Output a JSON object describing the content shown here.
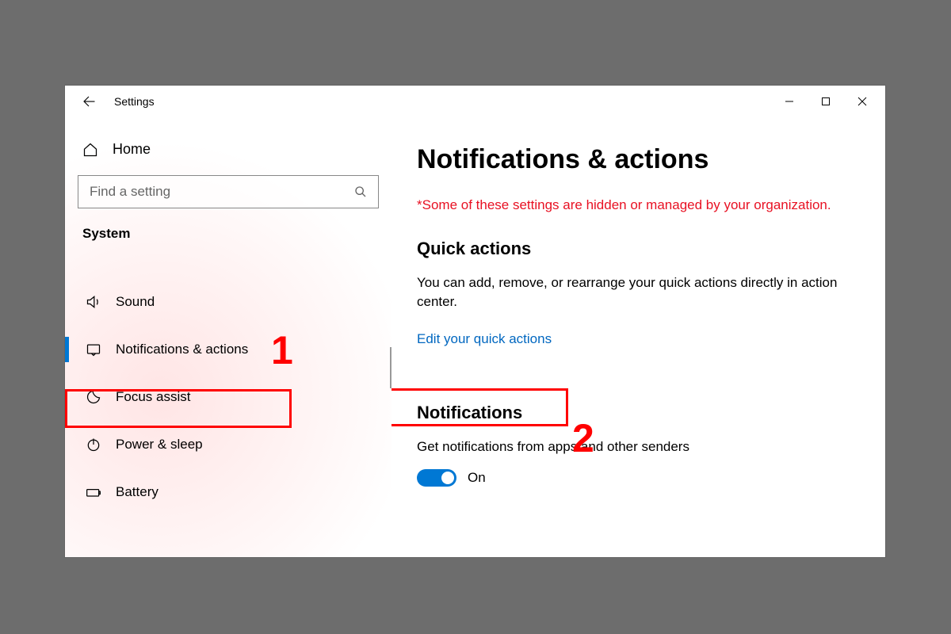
{
  "titlebar": {
    "app_title": "Settings"
  },
  "window_controls": {
    "minimize_name": "minimize-icon",
    "maximize_name": "maximize-icon",
    "close_name": "close-icon"
  },
  "sidebar": {
    "home_label": "Home",
    "search_placeholder": "Find a setting",
    "category_label": "System",
    "items": [
      {
        "icon": "sound-icon",
        "label": "Sound",
        "selected": false
      },
      {
        "icon": "notifications-icon",
        "label": "Notifications & actions",
        "selected": true
      },
      {
        "icon": "focus-assist-icon",
        "label": "Focus assist",
        "selected": false
      },
      {
        "icon": "power-sleep-icon",
        "label": "Power & sleep",
        "selected": false
      },
      {
        "icon": "battery-icon",
        "label": "Battery",
        "selected": false
      }
    ]
  },
  "main": {
    "heading": "Notifications & actions",
    "managed_note": "*Some of these settings are hidden or managed by your organization.",
    "quick_actions": {
      "heading": "Quick actions",
      "description": "You can add, remove, or rearrange your quick actions directly in action center.",
      "edit_link": "Edit your quick actions"
    },
    "notifications": {
      "heading": "Notifications",
      "description": "Get notifications from apps and other senders",
      "toggle_state": "On"
    }
  },
  "annotations": {
    "one": "1",
    "two": "2"
  },
  "colors": {
    "link": "#0067c0",
    "accent": "#0078d4",
    "alert": "#e81123",
    "annotation": "#ff0000"
  }
}
